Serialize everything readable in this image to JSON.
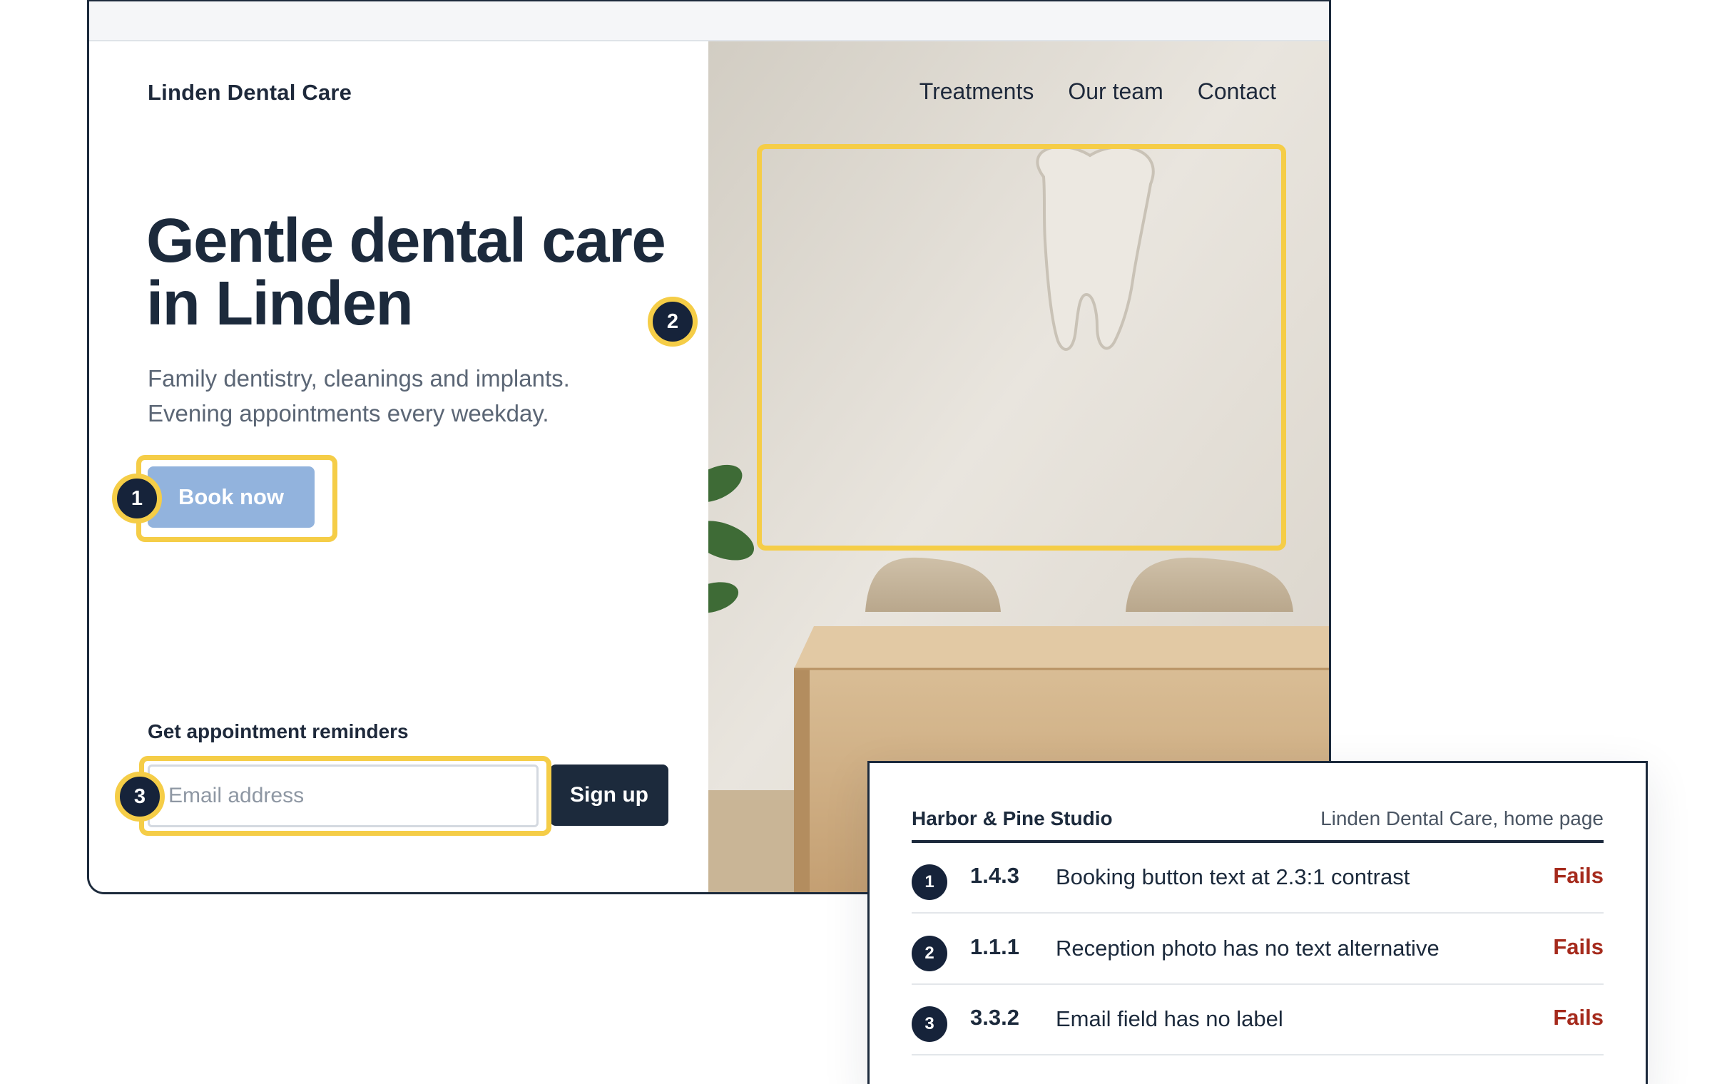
{
  "site": {
    "brand": "Linden Dental Care",
    "nav": [
      "Treatments",
      "Our team",
      "Contact"
    ],
    "hero": {
      "title": "Gentle dental care in Linden",
      "subtitle": "Family dentistry, cleanings and implants. Evening appointments every weekday.",
      "cta_label": "Book now"
    },
    "reminders": {
      "label": "Get appointment reminders",
      "email_placeholder": "Email address",
      "signup_label": "Sign up"
    },
    "photo_description_icons": [
      "tooth-wall-sculpture",
      "chairs",
      "reception-desk",
      "plant"
    ]
  },
  "annotations": [
    "1",
    "2",
    "3"
  ],
  "audit": {
    "studio": "Harbor & Pine Studio",
    "page": "Linden Dental Care, home page",
    "issues": [
      {
        "num": "1",
        "criterion": "1.4.3",
        "text": "Booking button text at 2.3:1 contrast",
        "status": "Fails"
      },
      {
        "num": "2",
        "criterion": "1.1.1",
        "text": "Reception photo has no text alternative",
        "status": "Fails"
      },
      {
        "num": "3",
        "criterion": "3.3.2",
        "text": "Email field has no label",
        "status": "Fails"
      }
    ]
  },
  "colors": {
    "navy": "#1c2a3c",
    "highlight": "#f5cd47",
    "cta_low_contrast": "#92b3dd",
    "fail_red": "#a52a1c"
  }
}
